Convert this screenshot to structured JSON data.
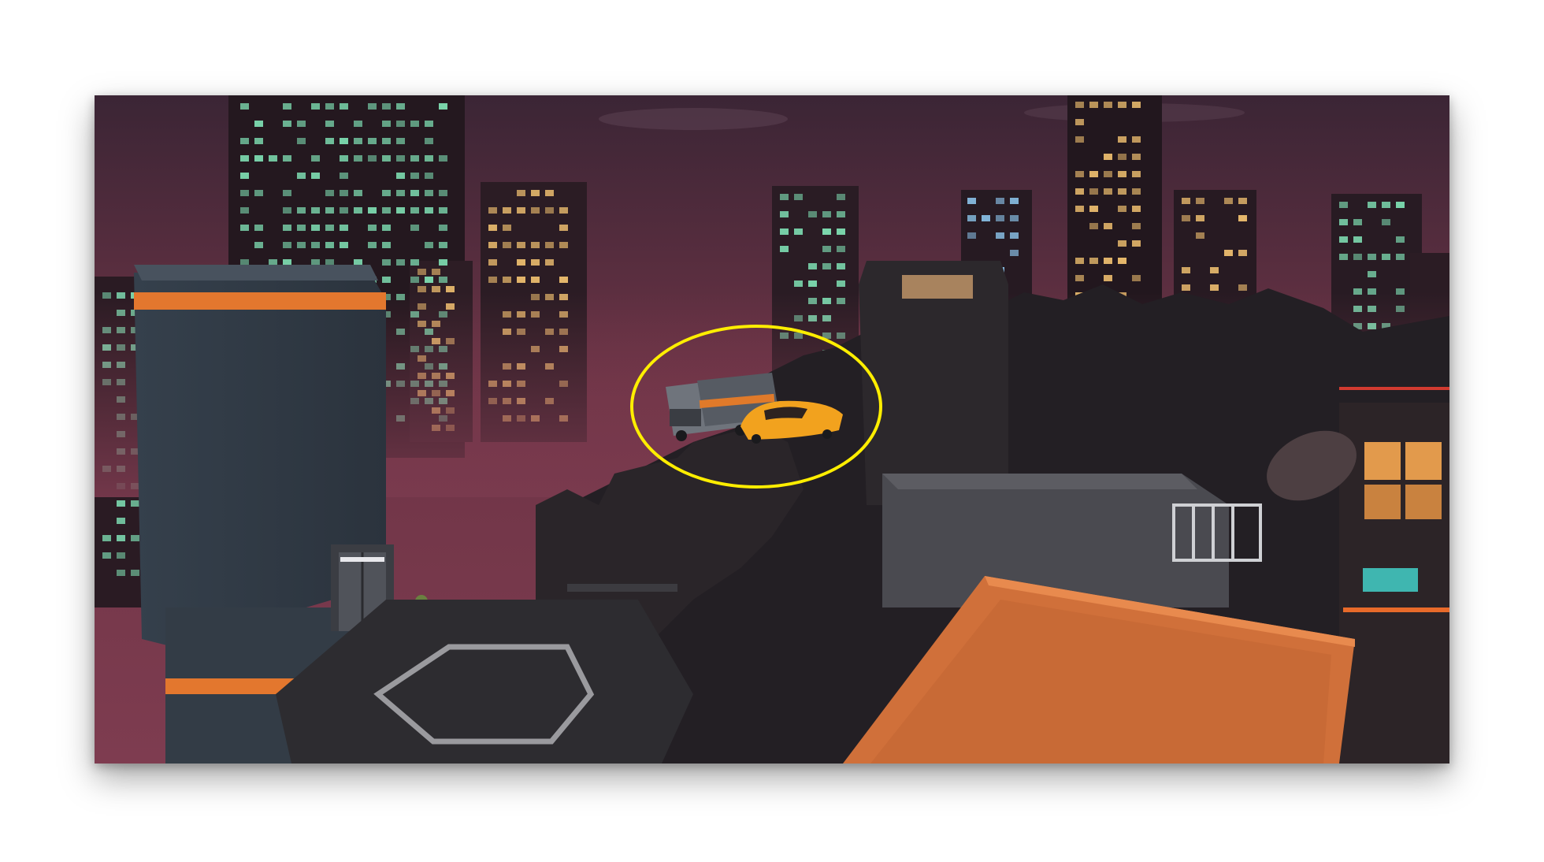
{
  "screenshot": {
    "scene": "night-city-rooftops",
    "highlight": {
      "shape": "ellipse",
      "color": "#ffee00",
      "target": "parked-vehicles"
    },
    "vehicles": [
      {
        "kind": "armored-truck",
        "color": "#8a8f98",
        "accent": "#e07a2a"
      },
      {
        "kind": "sports-car",
        "color": "#f2a21e"
      }
    ]
  },
  "colors": {
    "sky_top": "#3b2535",
    "sky_bottom": "#7a3a4e",
    "building_dark": "#1f1a1e",
    "window_green": "#7fe0b4",
    "window_amber": "#f0c070",
    "window_blue": "#8ec8f0",
    "tower_blue": "#3a4452",
    "accent_orange": "#e3772e",
    "roof_orange": "#d0703a",
    "helipad": "#2d2c30"
  }
}
